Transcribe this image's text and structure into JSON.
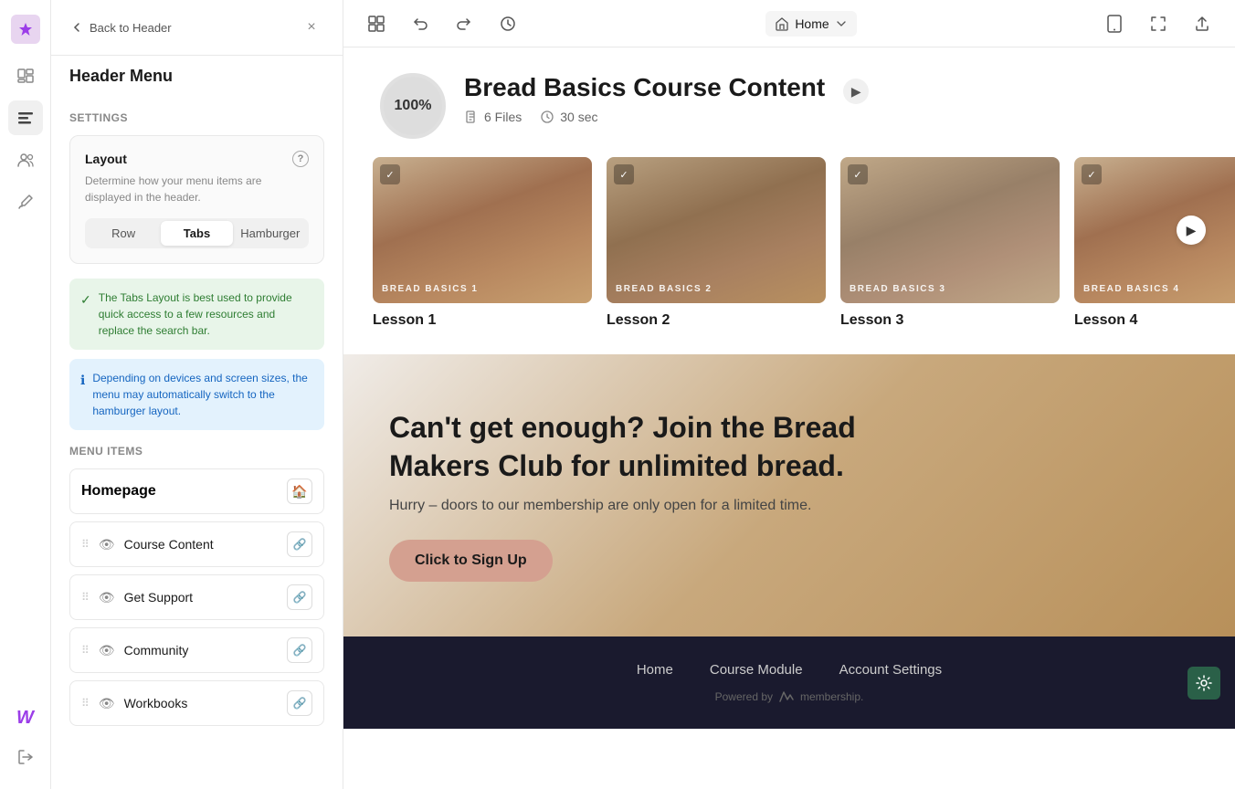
{
  "app": {
    "logo": "✦",
    "w_logo": "W"
  },
  "panel": {
    "back_label": "Back to Header",
    "close_icon": "×",
    "title": "Header Menu",
    "settings_section": "Settings",
    "layout_card": {
      "title": "Layout",
      "help_icon": "?",
      "description": "Determine how your menu items are displayed in the header.",
      "options": [
        "Row",
        "Tabs",
        "Hamburger"
      ],
      "active": "Tabs"
    },
    "info_tabs": {
      "icon": "✓",
      "text": "The Tabs Layout is best used to provide quick access to a few resources and replace the search bar."
    },
    "info_devices": {
      "icon": "ℹ",
      "text": "Depending on devices and screen sizes, the menu may automatically switch to the hamburger layout."
    },
    "menu_items_section": "Menu Items",
    "menu_items": [
      {
        "label": "Homepage",
        "is_homepage": true,
        "icon": "🏠"
      },
      {
        "label": "Course Content",
        "icon": "📺",
        "link_icon": "🔗"
      },
      {
        "label": "Get Support",
        "icon": "👁",
        "link_icon": "🔗"
      },
      {
        "label": "Community",
        "icon": "👁",
        "link_icon": "🔗"
      },
      {
        "label": "Workbooks",
        "icon": "👁",
        "link_icon": "🔗"
      }
    ]
  },
  "toolbar": {
    "undo_icon": "↩",
    "redo_icon": "↪",
    "history_icon": "⏱",
    "layout_icon": "⊞",
    "home_label": "Home",
    "chevron_icon": "▾",
    "mobile_icon": "📱",
    "expand_icon": "⤢",
    "share_icon": "⬆"
  },
  "course": {
    "progress": "100%",
    "title": "Bread Basics Course Content",
    "files_count": "6 Files",
    "duration": "30 sec",
    "lessons": [
      {
        "number": 1,
        "label": "Bread Basics 1",
        "name": "Lesson 1"
      },
      {
        "number": 2,
        "label": "Bread Basics 2",
        "name": "Lesson 2"
      },
      {
        "number": 3,
        "label": "Bread Basics 3",
        "name": "Lesson 3"
      },
      {
        "number": 4,
        "label": "Bread Basics 4",
        "name": "Lesson 4"
      }
    ]
  },
  "cta": {
    "headline": "Can't get enough? Join the Bread Makers Club for unlimited bread.",
    "subtext": "Hurry – doors to our membership are only open for a limited time.",
    "button_label": "Click to Sign Up"
  },
  "footer": {
    "nav_links": [
      "Home",
      "Course Module",
      "Account Settings"
    ],
    "powered_by": "Powered by",
    "brand": "membership."
  }
}
